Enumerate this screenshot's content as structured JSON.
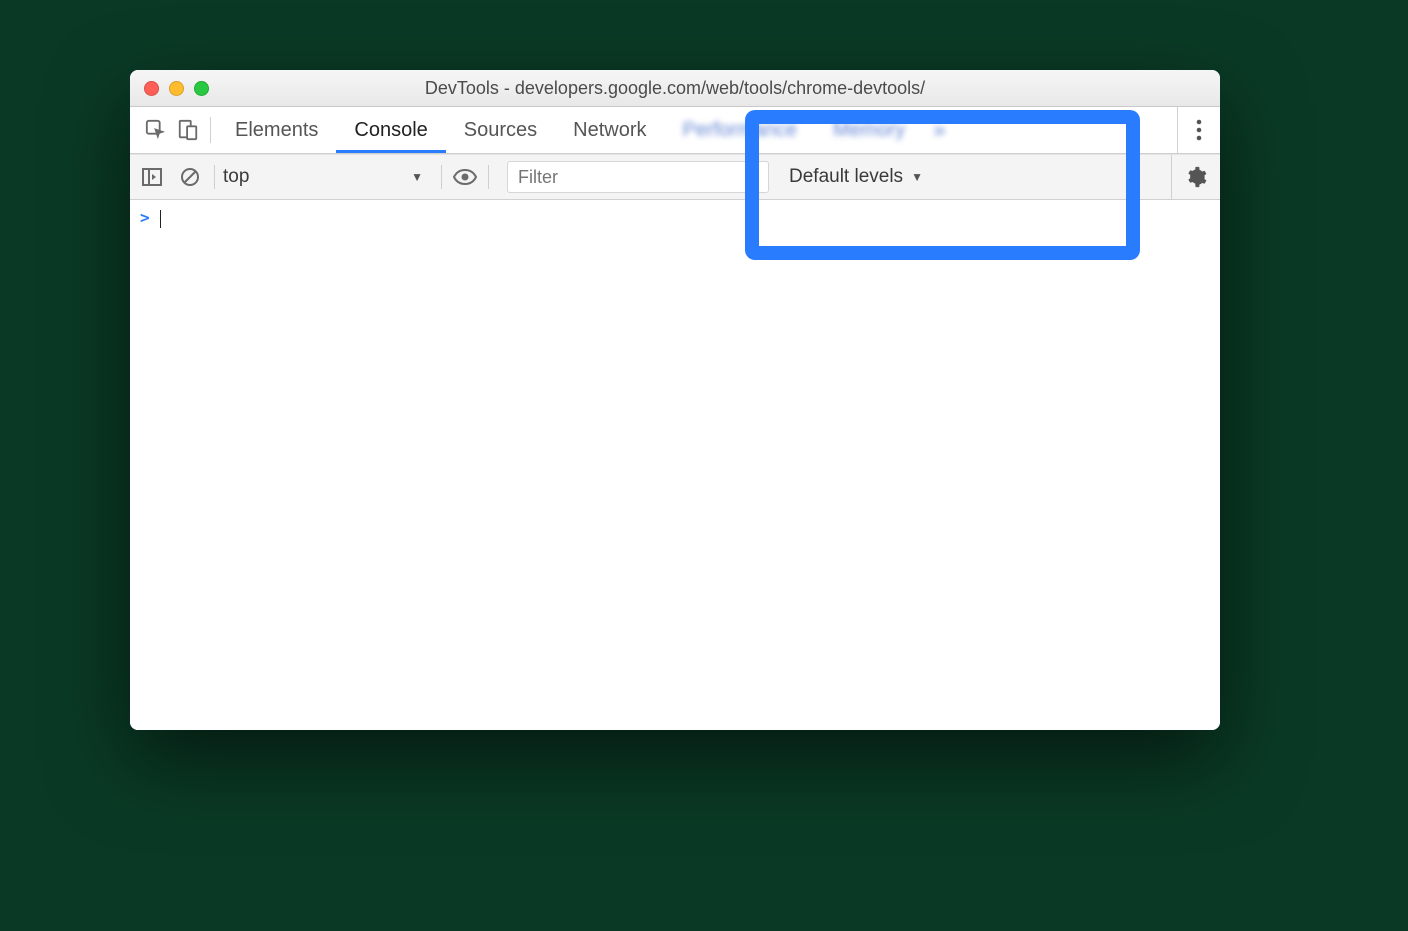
{
  "window": {
    "title": "DevTools - developers.google.com/web/tools/chrome-devtools/"
  },
  "tabs": {
    "elements": "Elements",
    "console": "Console",
    "sources": "Sources",
    "network": "Network",
    "performance": "Performance",
    "memory": "Memory"
  },
  "consoleToolbar": {
    "context": "top",
    "filterPlaceholder": "Filter",
    "levels": "Default levels"
  },
  "prompt": ">"
}
